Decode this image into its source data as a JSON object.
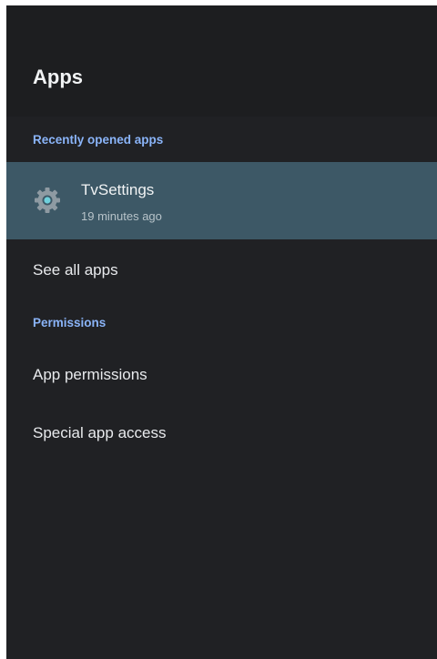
{
  "header": {
    "title": "Apps"
  },
  "sections": {
    "recent_label": "Recently opened apps",
    "permissions_label": "Permissions"
  },
  "recent_app": {
    "name": "TvSettings",
    "subtitle": "19 minutes ago",
    "icon": "gear-icon"
  },
  "menu": {
    "see_all": "See all apps",
    "app_permissions": "App permissions",
    "special_access": "Special app access"
  },
  "colors": {
    "background": "#202124",
    "header_background": "#1d1e20",
    "selected_row": "#3d5866",
    "accent": "#8ab4f8",
    "text": "#e8eaed"
  }
}
